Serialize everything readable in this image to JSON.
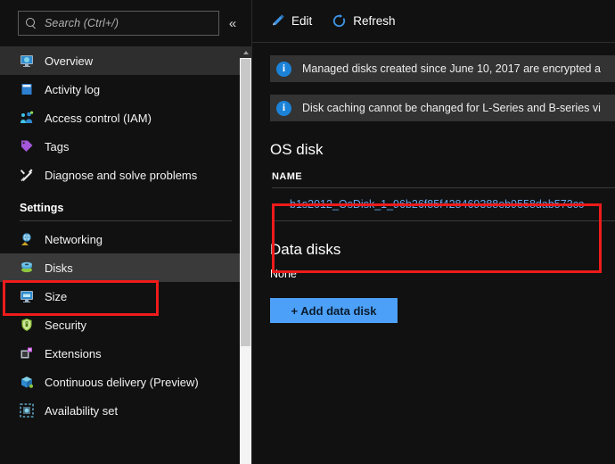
{
  "sidebar": {
    "search": {
      "placeholder": "Search (Ctrl+/)",
      "icon": "search-icon"
    },
    "collapse_icon": "chevron-double-left-icon",
    "items": [
      {
        "label": "Overview",
        "icon": "overview-monitor-icon",
        "state": "selected"
      },
      {
        "label": "Activity log",
        "icon": "activity-log-icon",
        "state": "normal"
      },
      {
        "label": "Access control (IAM)",
        "icon": "access-control-icon",
        "state": "normal"
      },
      {
        "label": "Tags",
        "icon": "tag-icon",
        "state": "normal"
      },
      {
        "label": "Diagnose and solve problems",
        "icon": "tools-wrench-icon",
        "state": "normal"
      }
    ],
    "section_label": "Settings",
    "settings_items": [
      {
        "label": "Networking",
        "icon": "networking-icon",
        "state": "normal"
      },
      {
        "label": "Disks",
        "icon": "disks-icon",
        "state": "active"
      },
      {
        "label": "Size",
        "icon": "size-monitor-icon",
        "state": "normal"
      },
      {
        "label": "Security",
        "icon": "shield-icon",
        "state": "normal"
      },
      {
        "label": "Extensions",
        "icon": "extensions-icon",
        "state": "normal"
      },
      {
        "label": "Continuous delivery (Preview)",
        "icon": "continuous-delivery-icon",
        "state": "normal"
      },
      {
        "label": "Availability set",
        "icon": "availability-set-icon",
        "state": "normal"
      }
    ]
  },
  "toolbar": {
    "edit_label": "Edit",
    "edit_icon": "pencil-icon",
    "refresh_label": "Refresh",
    "refresh_icon": "refresh-icon"
  },
  "banners": [
    {
      "icon": "info-icon",
      "glyph": "i",
      "text": "Managed disks created since June 10, 2017 are encrypted a"
    },
    {
      "icon": "info-icon",
      "glyph": "i",
      "text": "Disk caching cannot be changed for L-Series and B-series vi"
    }
  ],
  "os_disk": {
    "title": "OS disk",
    "column_header": "NAME",
    "rows": [
      {
        "name": "b1s2012_OsDisk_1_96b26f85f428469388eb9558dab573cc"
      }
    ]
  },
  "data_disks": {
    "title": "Data disks",
    "empty_text": "None",
    "add_button_label": "+ Add data disk"
  },
  "colors": {
    "accent_blue": "#4da0f7",
    "link_blue": "#6aa6ea",
    "annotation_red": "#ee1b1b",
    "banner_bg": "#333333",
    "info_icon_blue": "#1b82d8"
  }
}
